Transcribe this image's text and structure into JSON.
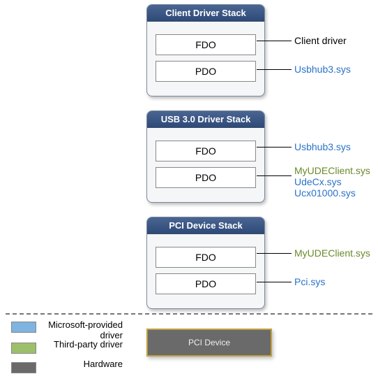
{
  "stacks": [
    {
      "title": "Client Driver Stack",
      "fdo": "FDO",
      "pdo": "PDO",
      "fdo_labels": [
        {
          "text": "Client driver",
          "cls": "blk"
        }
      ],
      "pdo_labels": [
        {
          "text": "Usbhub3.sys",
          "cls": "ms"
        }
      ]
    },
    {
      "title": "USB 3.0 Driver Stack",
      "fdo": "FDO",
      "pdo": "PDO",
      "fdo_labels": [
        {
          "text": "Usbhub3.sys",
          "cls": "ms"
        }
      ],
      "pdo_labels": [
        {
          "text": "MyUDEClient.sys",
          "cls": "tp"
        },
        {
          "text": "UdeCx.sys",
          "cls": "ms"
        },
        {
          "text": "Ucx01000.sys",
          "cls": "ms"
        }
      ]
    },
    {
      "title": "PCI Device Stack",
      "fdo": "FDO",
      "pdo": "PDO",
      "fdo_labels": [
        {
          "text": "MyUDEClient.sys",
          "cls": "tp"
        }
      ],
      "pdo_labels": [
        {
          "text": "Pci.sys",
          "cls": "ms"
        }
      ]
    }
  ],
  "legend": {
    "ms": "Microsoft-provided driver",
    "tp": "Third-party driver",
    "hw": "Hardware"
  },
  "pci_device": "PCI Device",
  "colors": {
    "ms": "#7fb3e0",
    "tp": "#9cc06a",
    "hw": "#6a6a6a"
  }
}
